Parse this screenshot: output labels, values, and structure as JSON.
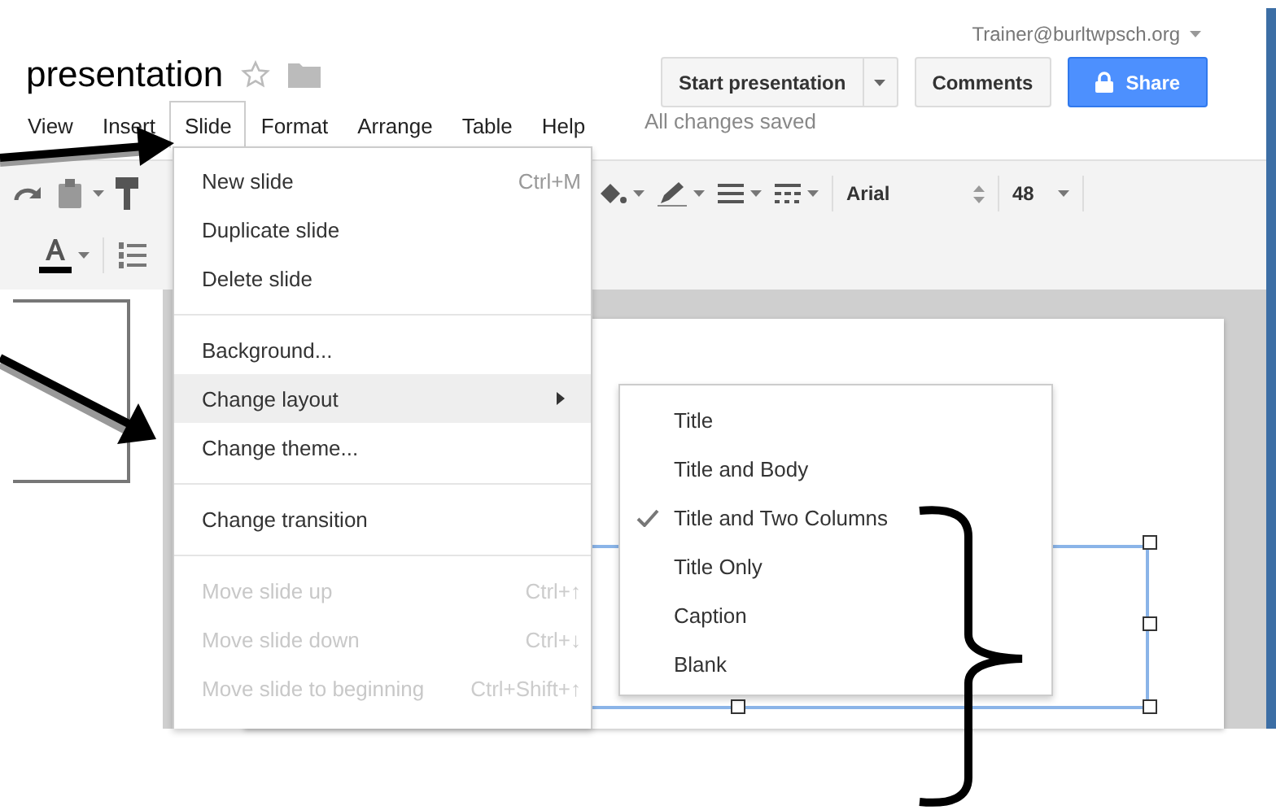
{
  "header": {
    "title": "presentation",
    "account": "Trainer@burltwpsch.org",
    "save_status": "All changes saved",
    "buttons": [
      {
        "label": "Start presentation",
        "kind": "split"
      },
      {
        "label": "Comments",
        "kind": "plain"
      },
      {
        "label": "Share",
        "kind": "primary"
      }
    ]
  },
  "menu_bar": [
    {
      "label": "View",
      "selected": false
    },
    {
      "label": "Insert",
      "selected": false
    },
    {
      "label": "Slide",
      "selected": true
    },
    {
      "label": "Format",
      "selected": false
    },
    {
      "label": "Arrange",
      "selected": false
    },
    {
      "label": "Table",
      "selected": false
    },
    {
      "label": "Help",
      "selected": false
    }
  ],
  "toolbar": {
    "font": "Arial",
    "font_size": "48"
  },
  "slide_menu": {
    "items": [
      {
        "kind": "item",
        "label": "New slide",
        "shortcut": "Ctrl+M",
        "disabled": false,
        "highlighted": false
      },
      {
        "kind": "item",
        "label": "Duplicate slide",
        "disabled": false,
        "highlighted": false
      },
      {
        "kind": "item",
        "label": "Delete slide",
        "disabled": false,
        "highlighted": false
      },
      {
        "kind": "separator"
      },
      {
        "kind": "item",
        "label": "Background...",
        "disabled": false,
        "highlighted": false
      },
      {
        "kind": "submenu",
        "label": "Change layout",
        "disabled": false,
        "highlighted": true
      },
      {
        "kind": "item",
        "label": "Change theme...",
        "disabled": false,
        "highlighted": false
      },
      {
        "kind": "separator"
      },
      {
        "kind": "item",
        "label": "Change transition",
        "disabled": false,
        "highlighted": false
      },
      {
        "kind": "separator"
      },
      {
        "kind": "item",
        "label": "Move slide up",
        "shortcut": "Ctrl+↑",
        "disabled": true,
        "highlighted": false
      },
      {
        "kind": "item",
        "label": "Move slide down",
        "shortcut": "Ctrl+↓",
        "disabled": true,
        "highlighted": false
      },
      {
        "kind": "item",
        "label": "Move slide to beginning",
        "shortcut": "Ctrl+Shift+↑",
        "disabled": true,
        "highlighted": false
      }
    ]
  },
  "layout_submenu": [
    {
      "label": "Title",
      "checked": false
    },
    {
      "label": "Title and Body",
      "checked": false
    },
    {
      "label": "Title and Two Columns",
      "checked": true
    },
    {
      "label": "Title Only",
      "checked": false
    },
    {
      "label": "Caption",
      "checked": false
    },
    {
      "label": "Blank",
      "checked": false
    }
  ]
}
